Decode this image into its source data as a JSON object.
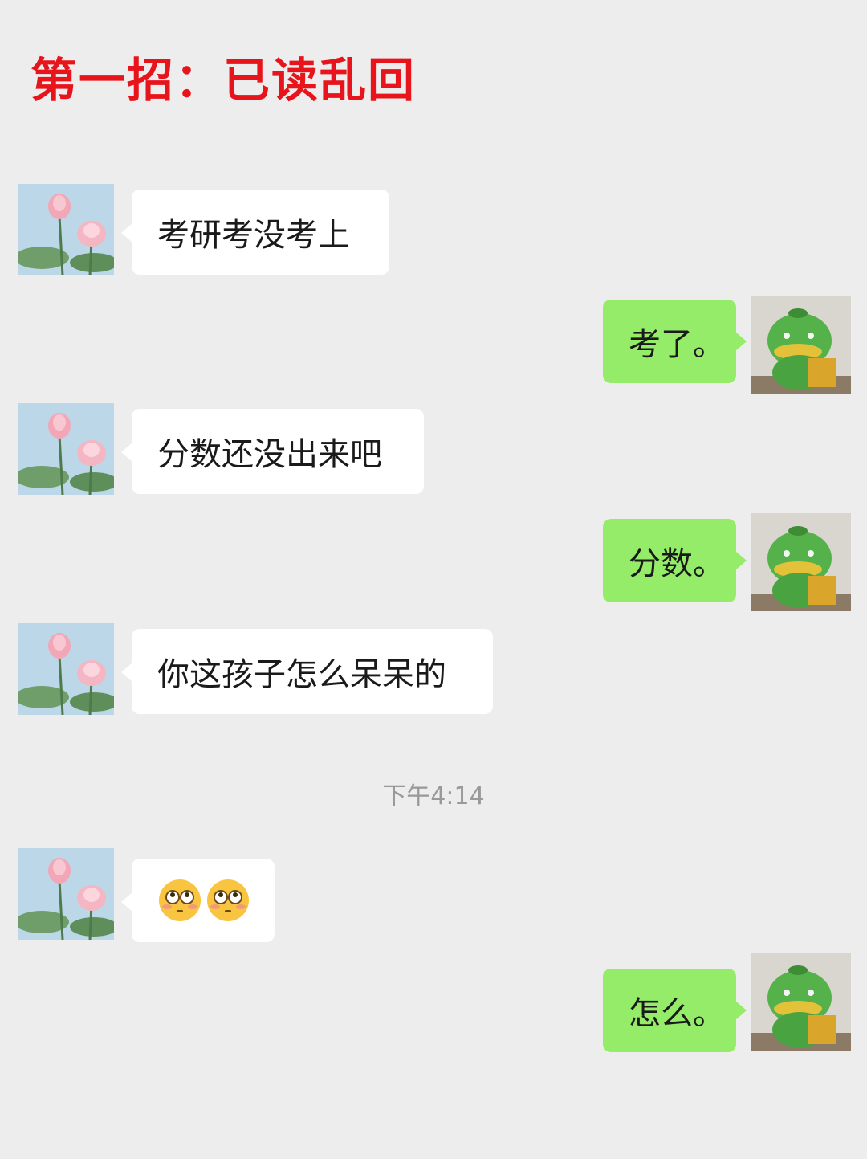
{
  "title": "第一招：已读乱回",
  "timestamp": "下午4:14",
  "contacts": {
    "left_avatar_icon": "lotus-avatar-icon",
    "right_avatar_icon": "green-duck-mascot-avatar-icon"
  },
  "messages": [
    {
      "side": "left",
      "text": "考研考没考上"
    },
    {
      "side": "right",
      "text": "考了。"
    },
    {
      "side": "left",
      "text": "分数还没出来吧"
    },
    {
      "side": "right",
      "text": "分数。"
    },
    {
      "side": "left",
      "text": "你这孩子怎么呆呆的"
    },
    {
      "side": "left",
      "emojis": [
        "flushed-face-emoji",
        "flushed-face-emoji"
      ]
    },
    {
      "side": "right",
      "text": "怎么。"
    }
  ],
  "colors": {
    "background": "#ededed",
    "incoming_bubble": "#ffffff",
    "outgoing_bubble": "#95ec69",
    "title": "#e8141b",
    "timestamp": "#999999"
  }
}
